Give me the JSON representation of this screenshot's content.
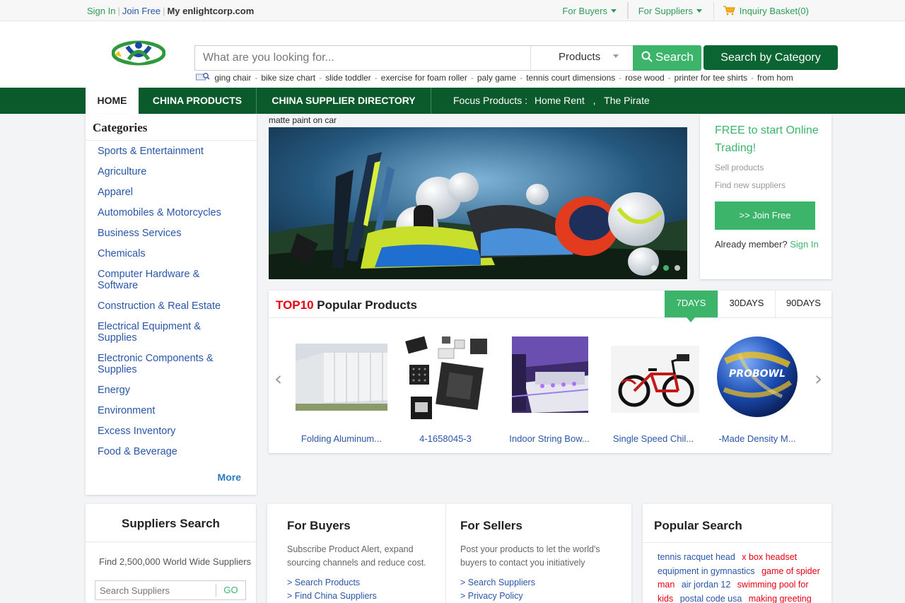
{
  "topbar": {
    "sign_in": "Sign In",
    "join_free": "Join Free",
    "my_site": "My enlightcorp.com",
    "for_buyers": "For Buyers",
    "for_suppliers": "For Suppliers",
    "inquiry_basket": "Inquiry Basket(0)"
  },
  "search": {
    "placeholder": "What are you looking for...",
    "type_select": "Products",
    "button": "Search",
    "category_button": "Search by Category",
    "hot_keywords": [
      "ging chair",
      "bike size chart",
      "slide toddler",
      "exercise for foam roller",
      "paly game",
      "tennis court dimensions",
      "rose wood",
      "printer for tee shirts",
      "from hom"
    ]
  },
  "nav": {
    "home": "HOME",
    "china_products": "CHINA PRODUCTS",
    "supplier_directory": "CHINA SUPPLIER DIRECTORY",
    "focus_label": "Focus Products :",
    "focus_items": [
      "Home Rent",
      "The Pirate"
    ],
    "focus_sep": ","
  },
  "categories": {
    "title": "Categories",
    "items": [
      "Sports & Entertainment",
      "Agriculture",
      "Apparel",
      "Automobiles & Motorcycles",
      "Business Services",
      "Chemicals",
      "Computer Hardware & Software",
      "Construction & Real Estate",
      "Electrical Equipment & Supplies",
      "Electronic Components & Supplies",
      "Energy",
      "Environment",
      "Excess Inventory",
      "Food & Beverage"
    ],
    "more": "More"
  },
  "banner": {
    "caption": "matte paint on car"
  },
  "side_panel": {
    "title": "FREE to start Online Trading!",
    "sell": "Sell products",
    "find": "Find new suppliers",
    "join_button": ">> Join Free",
    "already_member": "Already member?",
    "sign_in": "Sign In"
  },
  "top10": {
    "title_red": "TOP10",
    "title_rest": "Popular Products",
    "tabs": [
      "7DAYS",
      "30DAYS",
      "90DAYS"
    ],
    "products": [
      {
        "name": "Folding Aluminum...",
        "icon": "tent-building-icon"
      },
      {
        "name": "4-1658045-3",
        "icon": "chips-icon"
      },
      {
        "name": "Indoor String Bow...",
        "icon": "bowling-lane-icon"
      },
      {
        "name": "Single Speed Chil...",
        "icon": "kids-bike-icon"
      },
      {
        "name": "-Made Density M...",
        "icon": "bowling-ball-icon"
      }
    ]
  },
  "suppliers_search": {
    "title": "Suppliers Search",
    "text": "Find 2,500,000 World Wide Suppliers",
    "placeholder": "Search Suppliers",
    "go": "GO"
  },
  "for_buyers": {
    "title": "For Buyers",
    "text": "Subscribe Product Alert, expand sourcing channels and reduce cost.",
    "links": [
      "> Search Products",
      "> Find China Suppliers"
    ]
  },
  "for_sellers": {
    "title": "For Sellers",
    "text": "Post your products to let the world's buyers to contact you initiatively",
    "links": [
      "> Search Suppliers",
      "> Privacy Policy"
    ]
  },
  "popular_search": {
    "title": "Popular Search",
    "tags": [
      {
        "t": "tennis racquet head",
        "c": "b"
      },
      {
        "t": "x box headset",
        "c": "rd"
      },
      {
        "t": "equipment in gymnastics",
        "c": "b"
      },
      {
        "t": "game of spider man",
        "c": "rd"
      },
      {
        "t": "air jordan 12",
        "c": "b"
      },
      {
        "t": "swimming pool for kids",
        "c": "rd"
      },
      {
        "t": "postal code usa",
        "c": "b"
      },
      {
        "t": "making greeting",
        "c": "rd"
      }
    ]
  },
  "colors": {
    "green": "#3cb56b",
    "dark_green": "#0a5a2c",
    "link_blue": "#2a56a8",
    "red": "#e60012"
  }
}
